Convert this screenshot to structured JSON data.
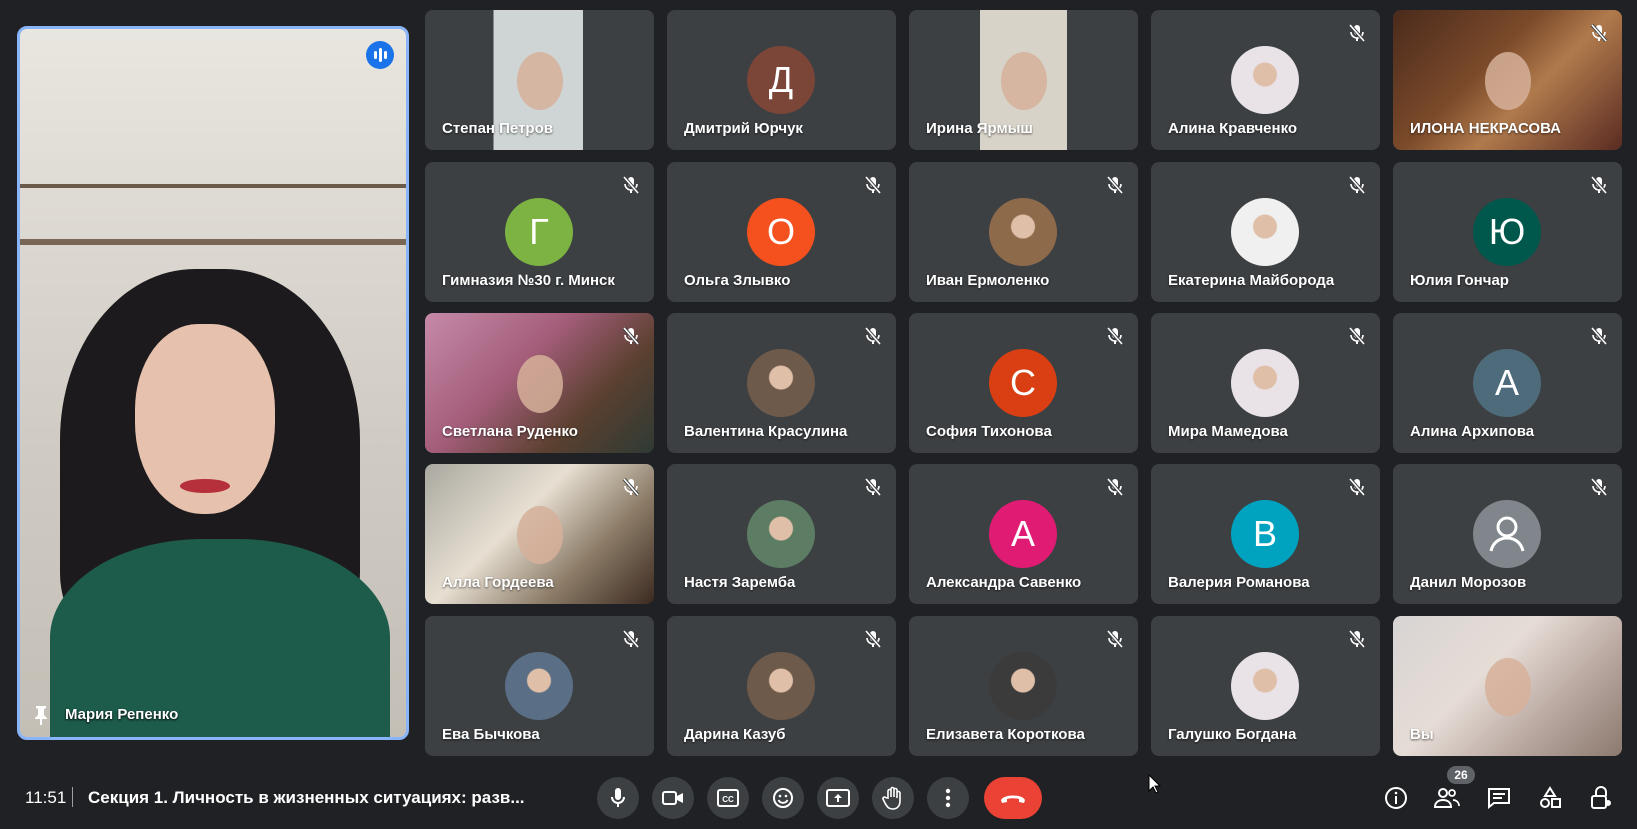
{
  "pinned": {
    "name": "Мария Репенко"
  },
  "participants": [
    {
      "name": "Степан Петров",
      "kind": "video",
      "muted": false
    },
    {
      "name": "Дмитрий Юрчук",
      "kind": "letter",
      "letter": "Д",
      "color": "#7b4538",
      "muted": false
    },
    {
      "name": "Ирина Ярмыш",
      "kind": "video",
      "muted": false
    },
    {
      "name": "Алина Кравченко",
      "kind": "photo",
      "muted": true
    },
    {
      "name": "ИЛОНА НЕКРАСОВА",
      "kind": "video",
      "muted": true
    },
    {
      "name": "Гимназия №30 г. Минск",
      "kind": "letter",
      "letter": "Г",
      "color": "#7cb342",
      "muted": true
    },
    {
      "name": "Ольга Злывко",
      "kind": "letter",
      "letter": "О",
      "color": "#f4511e",
      "muted": true
    },
    {
      "name": "Иван Ермоленко",
      "kind": "photo",
      "muted": true
    },
    {
      "name": "Екатерина Майборода",
      "kind": "photo",
      "muted": true
    },
    {
      "name": "Юлия Гончар",
      "kind": "letter",
      "letter": "Ю",
      "color": "#00574b",
      "muted": true
    },
    {
      "name": "Светлана Руденко",
      "kind": "video",
      "muted": true
    },
    {
      "name": "Валентина Красулина",
      "kind": "photo",
      "muted": true
    },
    {
      "name": "София Тихонова",
      "kind": "letter",
      "letter": "С",
      "color": "#d93f12",
      "muted": true
    },
    {
      "name": "Мира Мамедова",
      "kind": "photo",
      "muted": true
    },
    {
      "name": "Алина Архипова",
      "kind": "letter",
      "letter": "А",
      "color": "#4d6b7a",
      "muted": true
    },
    {
      "name": "Алла Гордеева",
      "kind": "video",
      "muted": true
    },
    {
      "name": "Настя Заремба",
      "kind": "photo",
      "muted": true
    },
    {
      "name": "Александра Савенко",
      "kind": "letter",
      "letter": "А",
      "color": "#e01b74",
      "muted": true
    },
    {
      "name": "Валерия Романова",
      "kind": "letter",
      "letter": "В",
      "color": "#00a3bf",
      "muted": true
    },
    {
      "name": "Данил Морозов",
      "kind": "default",
      "muted": true
    },
    {
      "name": "Ева Бычкова",
      "kind": "photo",
      "muted": true
    },
    {
      "name": "Дарина Казуб",
      "kind": "photo",
      "muted": true
    },
    {
      "name": "Елизавета Короткова",
      "kind": "photo",
      "muted": true
    },
    {
      "name": "Галушко Богдана",
      "kind": "photo",
      "muted": true
    },
    {
      "name": "Вы",
      "kind": "video",
      "muted": false
    }
  ],
  "bottom": {
    "time": "11:51",
    "separator": "|",
    "meeting_title": "Секция 1. Личность в жизненных ситуациях: разв...",
    "participant_count": "26"
  },
  "colors": {
    "accent": "#8ab4f8",
    "end_call": "#ea4335",
    "tile_bg": "#3c4043",
    "page_bg": "#202124"
  }
}
